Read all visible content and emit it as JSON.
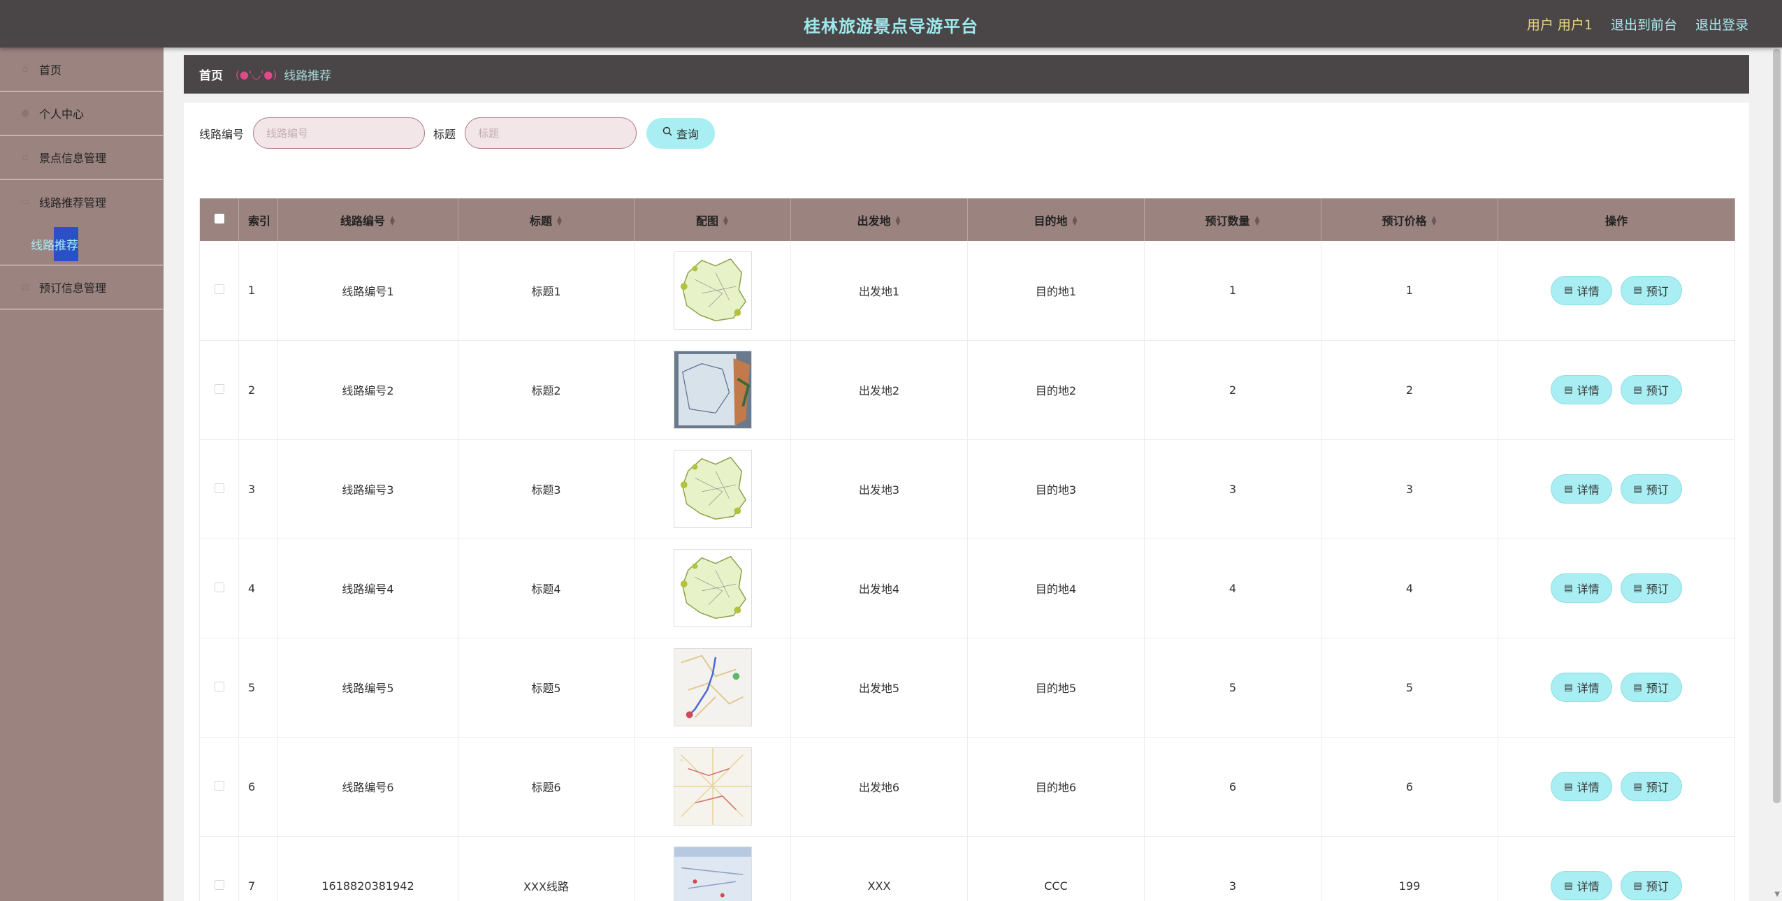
{
  "header": {
    "title": "桂林旅游景点导游平台",
    "user": "用户 用户1",
    "to_front": "退出到前台",
    "logout": "退出登录"
  },
  "sidebar": {
    "items": [
      {
        "label": "首页",
        "icon": "home-icon"
      },
      {
        "label": "个人中心",
        "icon": "user-icon"
      },
      {
        "label": "景点信息管理",
        "icon": "box-icon"
      },
      {
        "label": "线路推荐管理",
        "icon": "route-icon"
      },
      {
        "label": "预订信息管理",
        "icon": "list-icon"
      }
    ],
    "sub_active": "线路推荐"
  },
  "breadcrumb": {
    "home": "首页",
    "face": "(●'◡'●)",
    "current": "线路推荐"
  },
  "search": {
    "field1_label": "线路编号",
    "field1_placeholder": "线路编号",
    "field2_label": "标题",
    "field2_placeholder": "标题",
    "query_label": "查询"
  },
  "table": {
    "headers": [
      "索引",
      "线路编号",
      "标题",
      "配图",
      "出发地",
      "目的地",
      "预订数量",
      "预订价格",
      "操作"
    ],
    "detail_label": "详情",
    "book_label": "预订",
    "rows": [
      {
        "index": "1",
        "code": "线路编号1",
        "title": "标题1",
        "image": "yunnan-map",
        "from": "出发地1",
        "to": "目的地1",
        "qty": "1",
        "price": "1"
      },
      {
        "index": "2",
        "code": "线路编号2",
        "title": "标题2",
        "image": "paper-map-photo",
        "from": "出发地2",
        "to": "目的地2",
        "qty": "2",
        "price": "2"
      },
      {
        "index": "3",
        "code": "线路编号3",
        "title": "标题3",
        "image": "yunnan-map",
        "from": "出发地3",
        "to": "目的地3",
        "qty": "3",
        "price": "3"
      },
      {
        "index": "4",
        "code": "线路编号4",
        "title": "标题4",
        "image": "yunnan-map",
        "from": "出发地4",
        "to": "目的地4",
        "qty": "4",
        "price": "4"
      },
      {
        "index": "5",
        "code": "线路编号5",
        "title": "标题5",
        "image": "road-map",
        "from": "出发地5",
        "to": "目的地5",
        "qty": "5",
        "price": "5"
      },
      {
        "index": "6",
        "code": "线路编号6",
        "title": "标题6",
        "image": "road-map-2",
        "from": "出发地6",
        "to": "目的地6",
        "qty": "6",
        "price": "6"
      },
      {
        "index": "7",
        "code": "1618820381942",
        "title": "XXX线路",
        "image": "tourist-map",
        "from": "XXX",
        "to": "CCC",
        "qty": "3",
        "price": "199"
      }
    ]
  },
  "colors": {
    "header_bg": "#4a4546",
    "title": "#9ee9ec",
    "sidebar_bg": "#9b8380",
    "accent_button": "#a8eef2",
    "active_highlight": "#2a4fc7"
  }
}
